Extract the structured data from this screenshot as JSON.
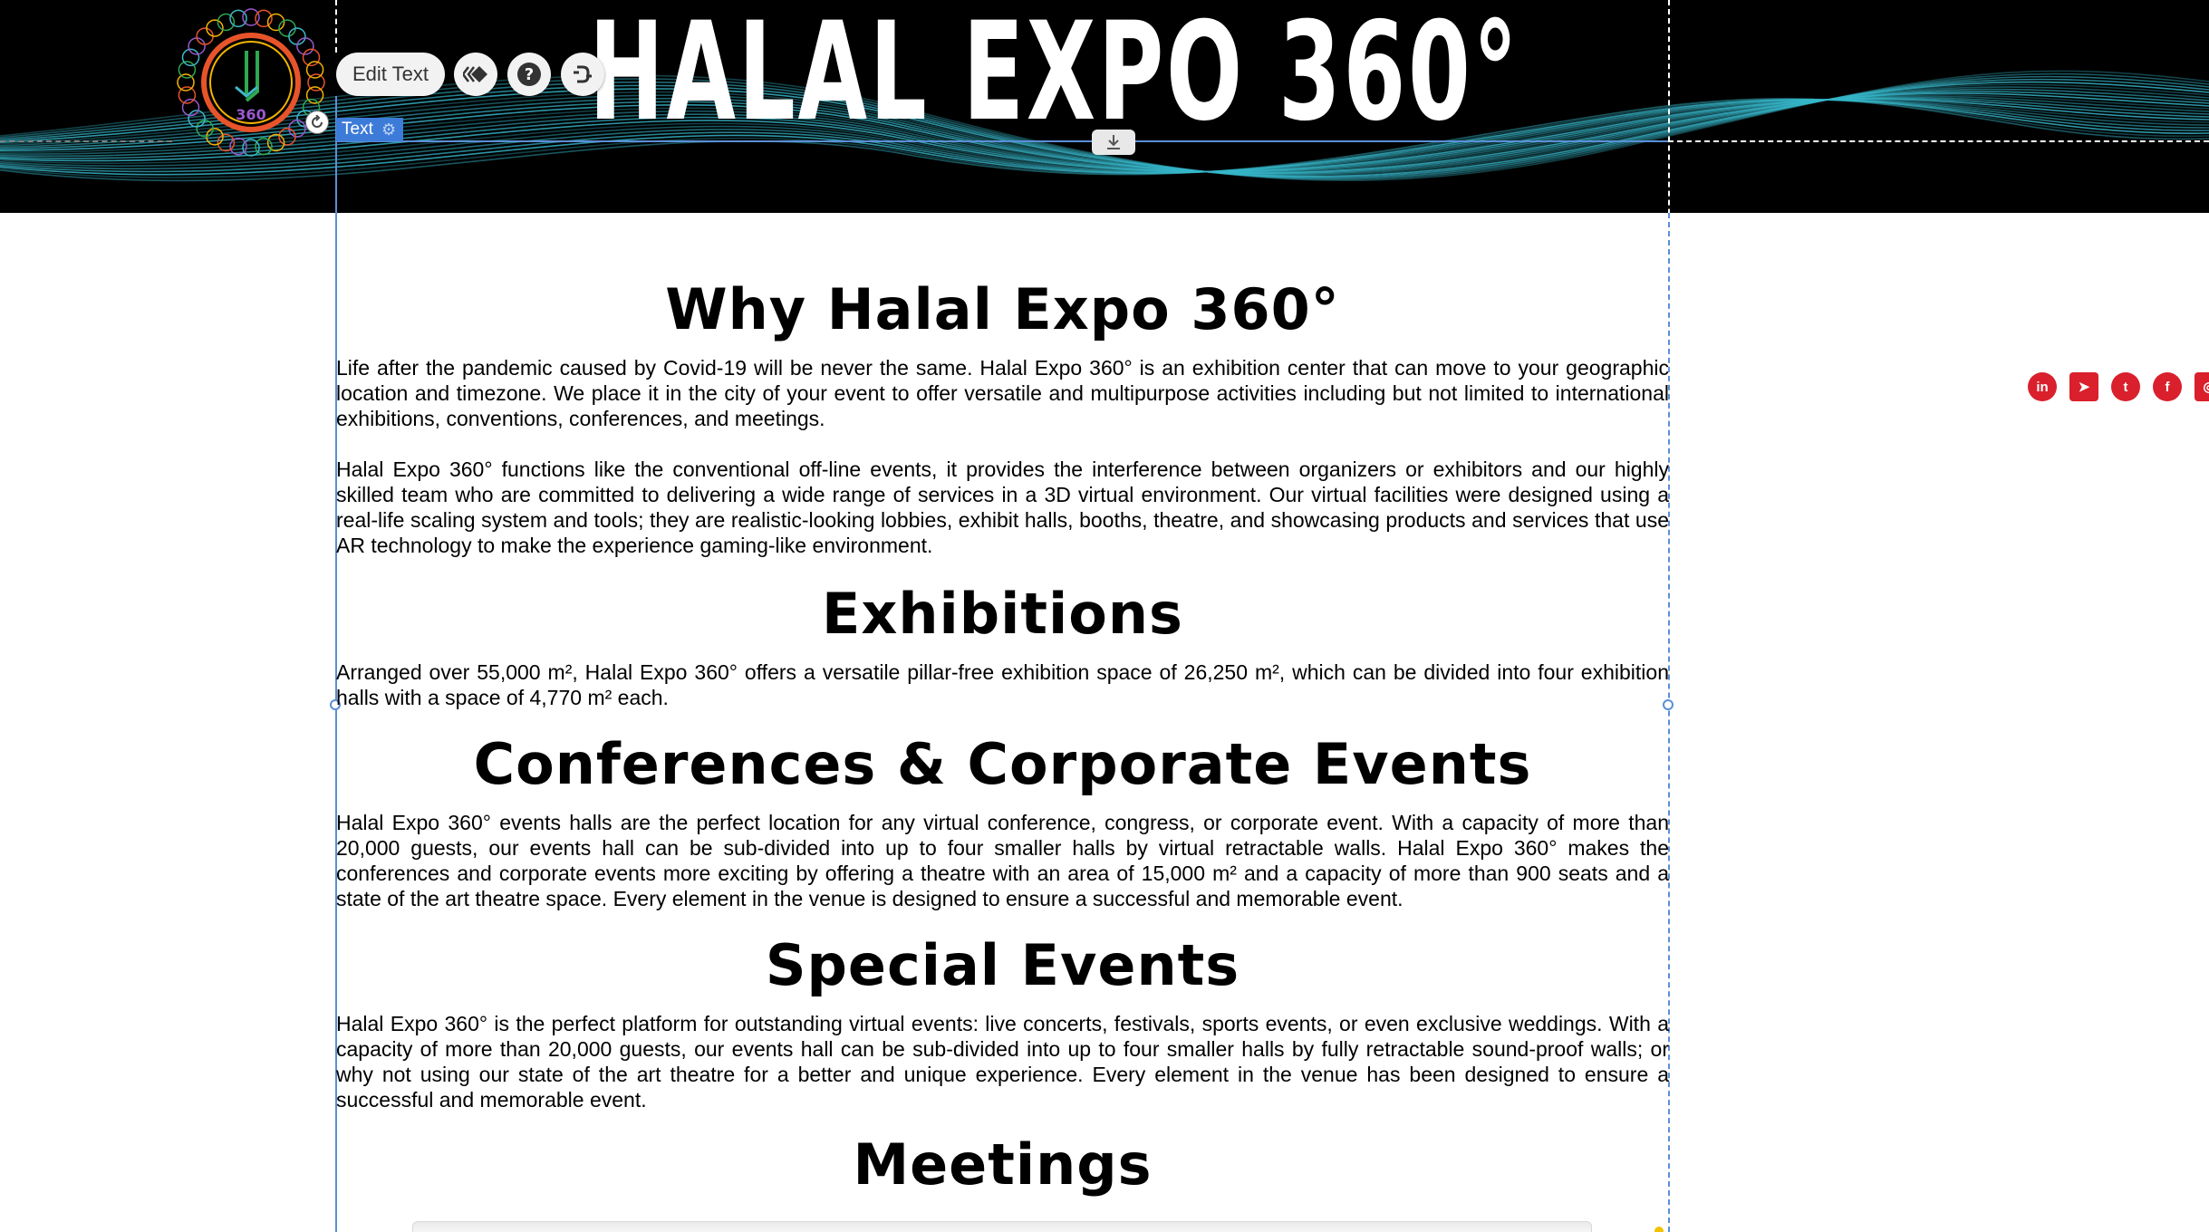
{
  "header": {
    "site_title": "HALAL EXPO 360°",
    "logo_text": "360"
  },
  "editor": {
    "edit_text_label": "Edit Text",
    "element_tag": "Text",
    "icons": [
      "animation-icon",
      "help-icon",
      "link-icon",
      "rotate-icon",
      "download-icon",
      "settings-icon"
    ]
  },
  "sections": [
    {
      "heading": "Why Halal Expo 360°",
      "paragraphs": [
        "Life after the pandemic caused by Covid-19 will be never the same. Halal Expo 360° is an exhibition center that can move to your geographic location and timezone. We place it in the city of your event to offer versatile and multipurpose activities including but not limited to international exhibitions, conventions, conferences, and meetings.",
        "Halal Expo 360° functions like the conventional off-line events, it provides the interference between organizers or exhibitors and our highly skilled team who are committed to delivering a wide range of services in a 3D virtual environment. Our virtual facilities were designed using a real-life scaling system and tools; they are realistic-looking lobbies, exhibit halls, booths, theatre, and showcasing products and services that use AR technology to make the experience gaming-like environment."
      ]
    },
    {
      "heading": "Exhibitions",
      "paragraphs": [
        "Arranged over 55,000 m², Halal Expo 360° offers a versatile pillar-free exhibition space of 26,250 m², which can be divided into four exhibition halls with a space of 4,770 m² each."
      ]
    },
    {
      "heading": "Conferences & Corporate Events",
      "paragraphs": [
        "Halal Expo 360° events halls are the perfect location for any virtual conference, congress, or corporate event. With a capacity of more than 20,000 guests, our events hall can be sub-divided into up to four smaller halls by virtual retractable walls. Halal Expo 360° makes the conferences and corporate events more exciting by offering a theatre with an area of 15,000 m² and a capacity of more than 900 seats and a state of the art theatre space. Every element in the venue is designed to ensure a successful and memorable event."
      ]
    },
    {
      "heading": "Special Events",
      "paragraphs": [
        "Halal Expo 360° is the perfect platform for outstanding virtual events: live concerts, festivals, sports events, or even exclusive weddings. With a capacity of more than 20,000 guests, our events hall can be sub-divided into up to four smaller halls by fully retractable sound-proof walls; or why not using our state of the art theatre for a better and unique experience. Every element in the venue has been designed to ensure a successful and memorable event."
      ]
    },
    {
      "heading": "Meetings",
      "paragraphs": []
    }
  ],
  "social": {
    "items": [
      {
        "name": "linkedin-icon",
        "glyph": "in"
      },
      {
        "name": "telegram-icon",
        "glyph": "➤"
      },
      {
        "name": "twitter-icon",
        "glyph": "t"
      },
      {
        "name": "facebook-icon",
        "glyph": "f"
      },
      {
        "name": "instagram-icon",
        "glyph": "◎"
      }
    ],
    "color": "#d9202c"
  },
  "colors": {
    "banner": "#000000",
    "wave": "#36b6c9",
    "selection": "#3d7bd9"
  }
}
